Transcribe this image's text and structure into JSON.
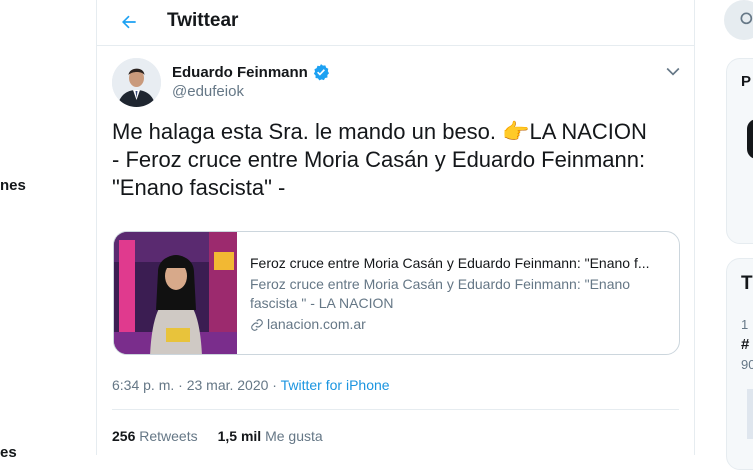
{
  "left_nav": {
    "fragment_1": "nes",
    "fragment_2": "es"
  },
  "header": {
    "back_icon": "arrow-left-icon",
    "title": "Twittear"
  },
  "tweet": {
    "author_name": "Eduardo Feinmann",
    "verified_icon": "verified-badge-icon",
    "handle": "@edufeiok",
    "text_line_1": "Me halaga esta Sra.  le mando un beso. 👉LA NACION",
    "text_line_2": "- Feroz cruce entre Moria Casán y Eduardo Feinmann:",
    "text_line_3": "\"Enano fascista\" -",
    "card": {
      "title": "Feroz cruce entre Moria Casán y Eduardo Feinmann: \"Enano f...",
      "description_line_1": "Feroz cruce entre Moria Casán y Eduardo Feinmann: \"Enano",
      "description_line_2": "fascista \" - LA NACION",
      "domain": "lanacion.com.ar"
    },
    "time": "6:34 p. m. · 23 mar. 2020 · ",
    "source": "Twitter for iPhone",
    "retweets_count": "256",
    "retweets_label": "Retweets",
    "likes_count": "1,5 mil",
    "likes_label": "Me gusta"
  },
  "right_column": {
    "frag_p": "P",
    "frag_t": "T",
    "frag_1": "1",
    "frag_hash": "#",
    "frag_90": "90"
  },
  "colors": {
    "accent": "#1da1f2",
    "link": "#1b95e0",
    "secondary_text": "#657786",
    "border": "#e6ecf0"
  }
}
